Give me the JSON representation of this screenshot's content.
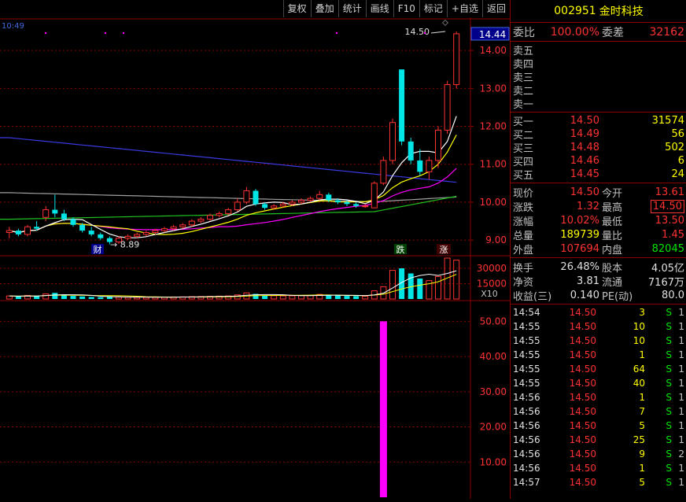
{
  "toolbar": {
    "items": [
      "复权",
      "叠加",
      "统计",
      "画线",
      "F10",
      "标记",
      "+自选",
      "返回"
    ]
  },
  "chart": {
    "time_label": "10:49",
    "last_price_tag": "14.44",
    "high_annotation": "14.50",
    "low_annotation": "8.89",
    "event_marker_1": "财",
    "event_marker_2": "跌",
    "event_marker_3": "涨",
    "price_ticks": [
      "14.00",
      "13.00",
      "12.00",
      "11.00",
      "10.00",
      "9.00"
    ],
    "volume_ticks": [
      "30000",
      "15000"
    ],
    "volume_unit": "X10",
    "indicator_ticks": [
      "50.00",
      "40.00",
      "30.00",
      "20.00",
      "10.00"
    ]
  },
  "chart_data": {
    "type": "candlestick",
    "price_axis": [
      9.0,
      14.0
    ],
    "candles": [
      [
        9.2,
        9.35,
        9.05,
        9.25
      ],
      [
        9.25,
        9.3,
        9.1,
        9.15
      ],
      [
        9.15,
        9.4,
        9.1,
        9.35
      ],
      [
        9.35,
        9.5,
        9.25,
        9.3
      ],
      [
        9.6,
        9.9,
        9.5,
        9.8
      ],
      [
        9.8,
        10.2,
        9.6,
        9.7
      ],
      [
        9.7,
        9.8,
        9.5,
        9.55
      ],
      [
        9.55,
        9.6,
        9.35,
        9.4
      ],
      [
        9.4,
        9.45,
        9.2,
        9.25
      ],
      [
        9.25,
        9.35,
        9.1,
        9.15
      ],
      [
        9.15,
        9.2,
        9.0,
        9.05
      ],
      [
        9.05,
        9.1,
        8.89,
        8.95
      ],
      [
        8.95,
        9.1,
        8.9,
        9.05
      ],
      [
        9.05,
        9.15,
        9.0,
        9.1
      ],
      [
        9.1,
        9.2,
        9.05,
        9.15
      ],
      [
        9.15,
        9.25,
        9.1,
        9.2
      ],
      [
        9.2,
        9.3,
        9.15,
        9.25
      ],
      [
        9.25,
        9.35,
        9.2,
        9.3
      ],
      [
        9.3,
        9.4,
        9.25,
        9.35
      ],
      [
        9.35,
        9.45,
        9.3,
        9.4
      ],
      [
        9.4,
        9.55,
        9.35,
        9.5
      ],
      [
        9.5,
        9.6,
        9.45,
        9.55
      ],
      [
        9.55,
        9.7,
        9.5,
        9.65
      ],
      [
        9.65,
        9.75,
        9.6,
        9.7
      ],
      [
        9.7,
        9.85,
        9.65,
        9.8
      ],
      [
        9.8,
        10.1,
        9.75,
        10.0
      ],
      [
        10.0,
        10.4,
        9.95,
        10.3
      ],
      [
        10.3,
        10.35,
        9.9,
        9.95
      ],
      [
        9.95,
        10.0,
        9.8,
        9.85
      ],
      [
        9.85,
        9.95,
        9.8,
        9.9
      ],
      [
        9.9,
        10.0,
        9.85,
        9.95
      ],
      [
        9.95,
        10.05,
        9.9,
        10.0
      ],
      [
        10.0,
        10.1,
        9.95,
        10.05
      ],
      [
        10.05,
        10.15,
        10.0,
        10.1
      ],
      [
        10.1,
        10.3,
        10.05,
        10.2
      ],
      [
        10.2,
        10.25,
        10.0,
        10.05
      ],
      [
        10.05,
        10.1,
        9.95,
        10.0
      ],
      [
        10.0,
        10.05,
        9.9,
        9.95
      ],
      [
        9.95,
        10.0,
        9.85,
        9.9
      ],
      [
        9.9,
        9.95,
        9.85,
        9.9
      ],
      [
        9.85,
        10.55,
        9.85,
        10.5
      ],
      [
        10.5,
        11.2,
        10.45,
        11.1
      ],
      [
        11.1,
        12.2,
        11.0,
        12.1
      ],
      [
        13.5,
        13.5,
        11.5,
        11.6
      ],
      [
        11.6,
        11.7,
        11.0,
        11.1
      ],
      [
        11.1,
        11.4,
        10.7,
        10.8
      ],
      [
        10.8,
        11.2,
        10.6,
        11.1
      ],
      [
        11.1,
        12.0,
        10.9,
        11.9
      ],
      [
        11.9,
        13.2,
        11.8,
        13.1
      ],
      [
        13.1,
        14.5,
        13.0,
        14.44
      ]
    ],
    "volumes_x10": [
      3000,
      2500,
      3500,
      2800,
      5000,
      6000,
      4000,
      3000,
      2500,
      2000,
      1800,
      2200,
      2000,
      1800,
      1600,
      1700,
      1800,
      1900,
      2000,
      2100,
      2300,
      2400,
      2600,
      2800,
      3000,
      4000,
      6000,
      5000,
      3500,
      3200,
      3000,
      3100,
      3300,
      3500,
      4500,
      4000,
      3500,
      3000,
      2800,
      2700,
      8000,
      12000,
      28000,
      30000,
      25000,
      20000,
      18000,
      22000,
      40000,
      38000
    ],
    "indicator_value": 50.0,
    "indicator_range": [
      0,
      55
    ]
  },
  "stock": {
    "code": "002951",
    "name": "金时科技"
  },
  "weibi": {
    "label": "委比",
    "value": "100.00%",
    "diff_label": "委差",
    "diff_value": "32162"
  },
  "sell_orders": [
    {
      "label": "卖五",
      "price": "",
      "vol": ""
    },
    {
      "label": "卖四",
      "price": "",
      "vol": ""
    },
    {
      "label": "卖三",
      "price": "",
      "vol": ""
    },
    {
      "label": "卖二",
      "price": "",
      "vol": ""
    },
    {
      "label": "卖一",
      "price": "",
      "vol": ""
    }
  ],
  "buy_orders": [
    {
      "label": "买一",
      "price": "14.50",
      "vol": "31574"
    },
    {
      "label": "买二",
      "price": "14.49",
      "vol": "56"
    },
    {
      "label": "买三",
      "price": "14.48",
      "vol": "502"
    },
    {
      "label": "买四",
      "price": "14.46",
      "vol": "6"
    },
    {
      "label": "买五",
      "price": "14.45",
      "vol": "24"
    }
  ],
  "quote": [
    {
      "l1": "现价",
      "v1": "14.50",
      "l2": "今开",
      "v2": "13.61"
    },
    {
      "l1": "涨跌",
      "v1": "1.32",
      "l2": "最高",
      "v2": "14.50"
    },
    {
      "l1": "涨幅",
      "v1": "10.02%",
      "l2": "最低",
      "v2": "13.50"
    },
    {
      "l1": "总量",
      "v1": "189739",
      "l2": "量比",
      "v2": "1.45"
    },
    {
      "l1": "外盘",
      "v1": "107694",
      "l2": "内盘",
      "v2": "82045"
    }
  ],
  "stats": [
    {
      "l1": "换手",
      "v1": "26.48%",
      "l2": "股本",
      "v2": "4.05亿"
    },
    {
      "l1": "净资",
      "v1": "3.81",
      "l2": "流通",
      "v2": "7167万"
    },
    {
      "l1": "收益(三)",
      "v1": "0.140",
      "l2": "PE(动)",
      "v2": "80.0"
    }
  ],
  "ticks": [
    {
      "time": "14:54",
      "price": "14.50",
      "vol": "3",
      "side": "S",
      "cnt": "1"
    },
    {
      "time": "14:55",
      "price": "14.50",
      "vol": "10",
      "side": "S",
      "cnt": "1"
    },
    {
      "time": "14:55",
      "price": "14.50",
      "vol": "10",
      "side": "S",
      "cnt": "1"
    },
    {
      "time": "14:55",
      "price": "14.50",
      "vol": "1",
      "side": "S",
      "cnt": "1"
    },
    {
      "time": "14:55",
      "price": "14.50",
      "vol": "64",
      "side": "S",
      "cnt": "1"
    },
    {
      "time": "14:55",
      "price": "14.50",
      "vol": "40",
      "side": "S",
      "cnt": "1"
    },
    {
      "time": "14:56",
      "price": "14.50",
      "vol": "1",
      "side": "S",
      "cnt": "1"
    },
    {
      "time": "14:56",
      "price": "14.50",
      "vol": "7",
      "side": "S",
      "cnt": "1"
    },
    {
      "time": "14:56",
      "price": "14.50",
      "vol": "5",
      "side": "S",
      "cnt": "1"
    },
    {
      "time": "14:56",
      "price": "14.50",
      "vol": "25",
      "side": "S",
      "cnt": "1"
    },
    {
      "time": "14:56",
      "price": "14.50",
      "vol": "9",
      "side": "S",
      "cnt": "2"
    },
    {
      "time": "14:56",
      "price": "14.50",
      "vol": "1",
      "side": "S",
      "cnt": "1"
    },
    {
      "time": "14:57",
      "price": "14.50",
      "vol": "5",
      "side": "S",
      "cnt": "1"
    }
  ]
}
